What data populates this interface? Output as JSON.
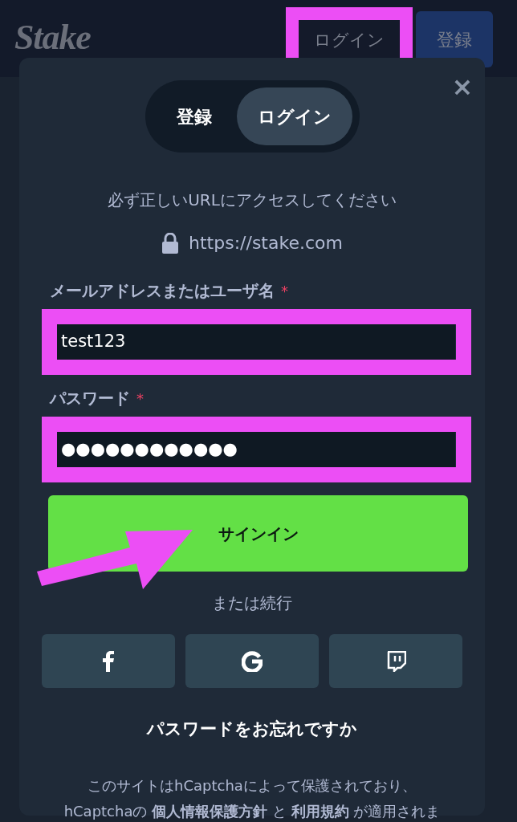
{
  "header": {
    "logo": "Stake",
    "login_button": {
      "label": "ログイン",
      "highlighted": true
    },
    "register_button": {
      "label": "登録"
    }
  },
  "modal": {
    "close": "×",
    "tabs": [
      {
        "label": "登録",
        "selected": false
      },
      {
        "label": "ログイン",
        "selected": true
      }
    ],
    "notice": "必ず正しいURLにアクセスしてください",
    "url": "https://stake.com",
    "fields": [
      {
        "label": "メールアドレスまたはユーザ名",
        "required_mark": "*",
        "value": "test123",
        "highlighted": true
      },
      {
        "label": "パスワード",
        "required_mark": "*",
        "value": "●●●●●●●●●●●●",
        "highlighted": true
      }
    ],
    "submit": {
      "label": "サインイン",
      "pointer_arrow": true
    },
    "divider_text": "または続行",
    "social": [
      {
        "kind": "facebook"
      },
      {
        "kind": "google"
      },
      {
        "kind": "twitch"
      }
    ],
    "forgot": "パスワードをお忘れですか",
    "captcha_lines": [
      "このサイトはhCaptchaによって保護されており、",
      "hCaptchaの **個人情報保護方針** と **利用規約** が適用されま"
    ]
  }
}
